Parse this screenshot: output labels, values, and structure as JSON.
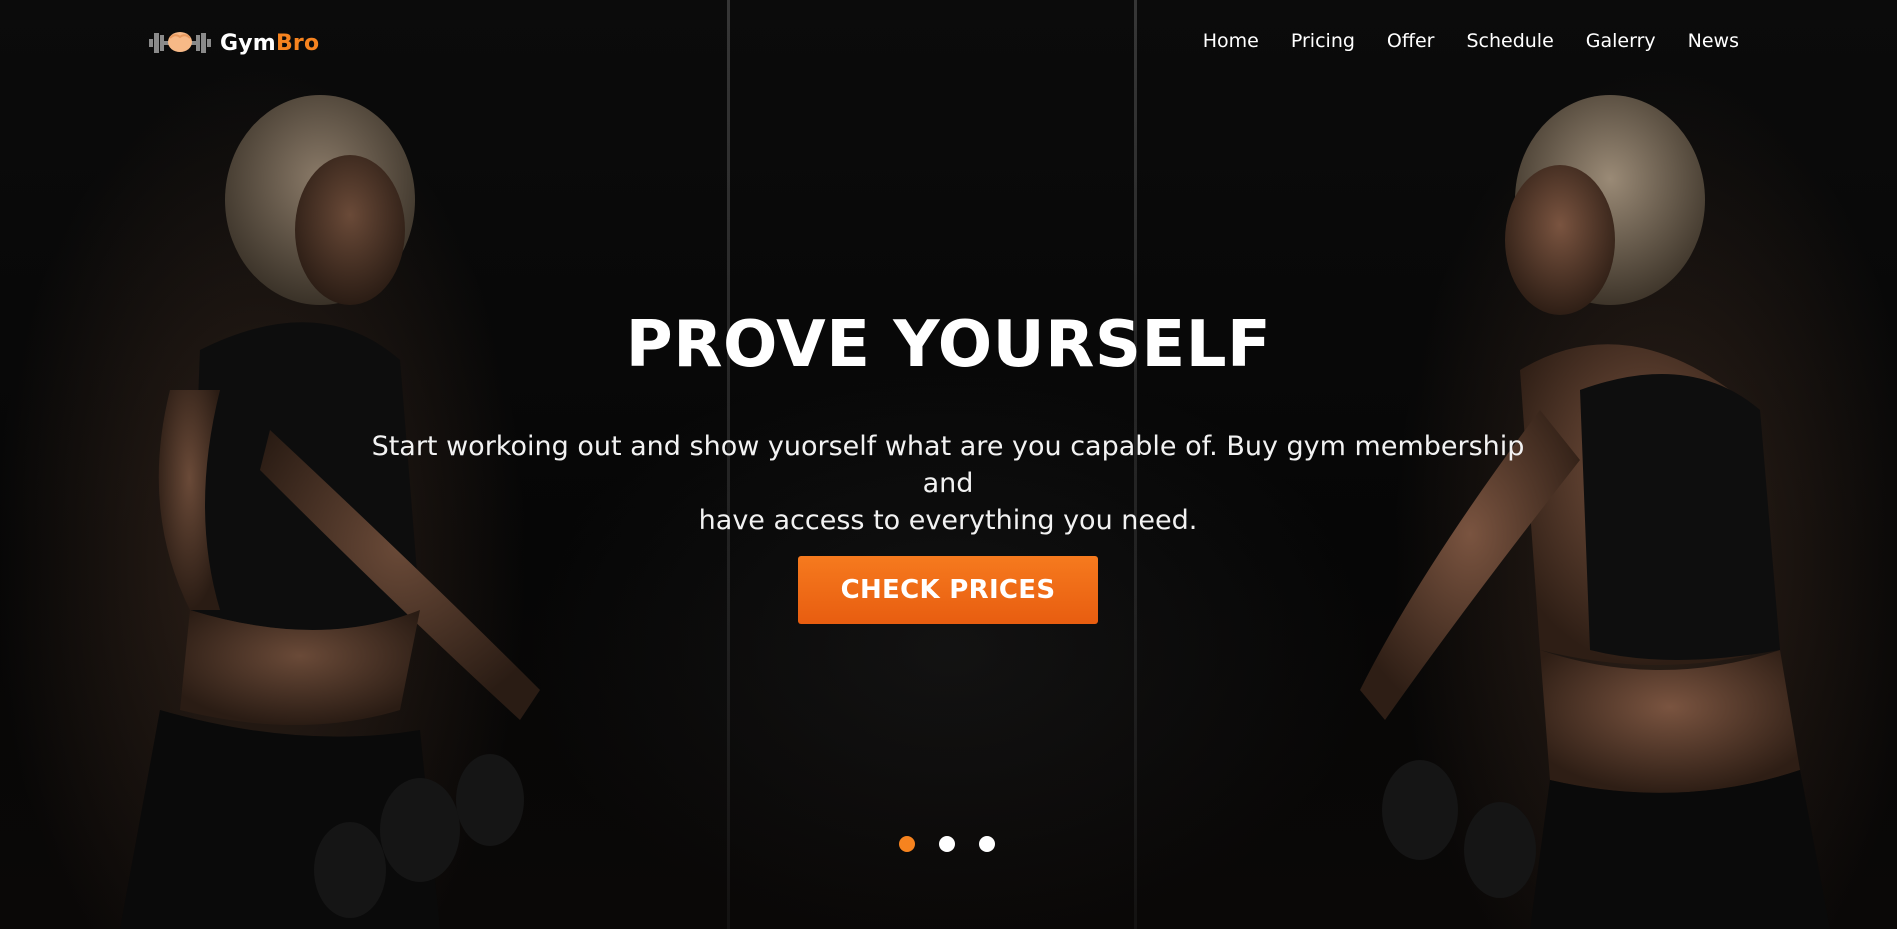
{
  "brand": {
    "name_main": "Gym",
    "name_accent": "Bro",
    "logo_icon": "dumbbell-fist-icon",
    "accent_color": "#f6831f"
  },
  "nav": {
    "items": [
      {
        "label": "Home"
      },
      {
        "label": "Pricing"
      },
      {
        "label": "Offer"
      },
      {
        "label": "Schedule"
      },
      {
        "label": "Galerry"
      },
      {
        "label": "News"
      }
    ]
  },
  "hero": {
    "title": "PROVE YOURSELF",
    "subtitle_line1": "Start workoing out and show yuorself what are you capable of. Buy gym membership and",
    "subtitle_line2": "have access to everything you need.",
    "cta_label": "CHECK PRICES",
    "cta_color": "#f06c18"
  },
  "slider": {
    "total_slides": 3,
    "active_slide": 1,
    "active_color": "#f6831f",
    "inactive_color": "#ffffff"
  }
}
